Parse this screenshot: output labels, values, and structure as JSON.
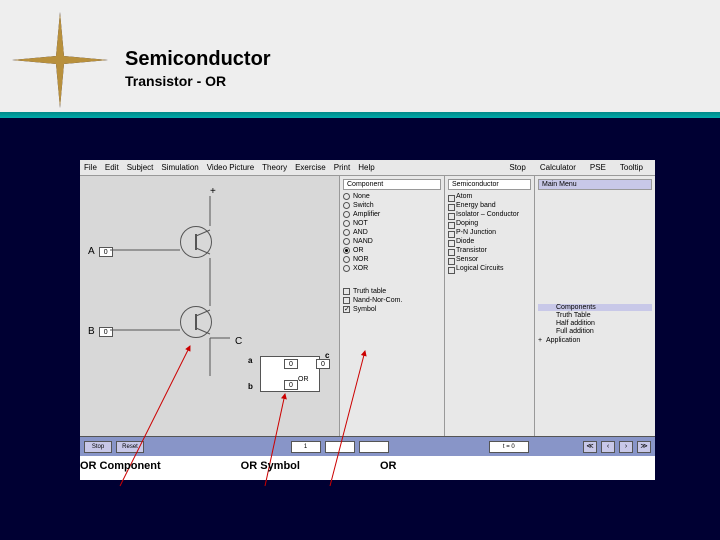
{
  "title": "Semiconductor",
  "subtitle": "Transistor   -   OR",
  "menu": {
    "file": "File",
    "edit": "Edit",
    "subject": "Subject",
    "simulation": "Simulation",
    "video": "Video Picture",
    "theory": "Theory",
    "exercise": "Exercise",
    "print": "Print",
    "help": "Help",
    "stop": "Stop",
    "calc": "Calculator",
    "pse": "PSE",
    "tooltip": "Tooltip"
  },
  "canvas": {
    "plus": "+",
    "labelA": "A",
    "labelB": "B",
    "labelC": "C",
    "zero": "0",
    "or_a": "a",
    "or_b": "b",
    "or_c": "c",
    "or_text": "OR"
  },
  "components": {
    "header": "Component",
    "items": [
      "None",
      "Switch",
      "Amplifier",
      "NOT",
      "AND",
      "NAND",
      "OR",
      "NOR",
      "XOR"
    ],
    "selected": 6,
    "checks": [
      {
        "label": "Truth table",
        "checked": false
      },
      {
        "label": "Nand-Nor-Com.",
        "checked": false
      },
      {
        "label": "Symbol",
        "checked": true
      }
    ]
  },
  "mid": {
    "header": "Semiconductor",
    "items": [
      "Atom",
      "Energy band",
      "Isolator – Conductor",
      "Doping",
      "P-N Junction",
      "Diode",
      "Transistor",
      "Sensor",
      "Logical Circuits"
    ]
  },
  "right": {
    "header": "Main Menu",
    "sub": [
      "Components",
      "Truth Table",
      "Half addition",
      "Full addition"
    ],
    "app": "Application"
  },
  "status": {
    "stop": "Stop",
    "reset": "Reset",
    "one": "1",
    "teq": "t = 0"
  },
  "annotations": {
    "a1": "OR Component",
    "a2": "OR Symbol",
    "a3": "OR"
  }
}
